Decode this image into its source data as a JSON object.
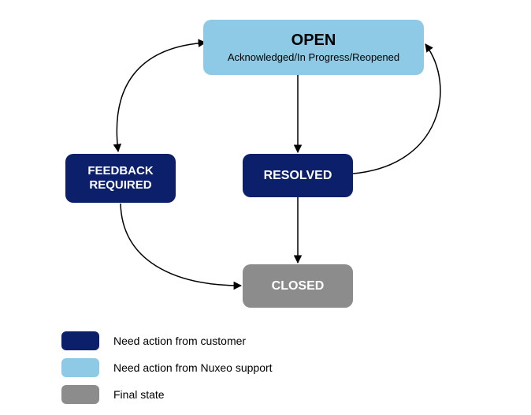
{
  "nodes": {
    "open": {
      "title": "OPEN",
      "subtitle": "Acknowledged/In Progress/Reopened"
    },
    "feedback": {
      "line1": "FEEDBACK",
      "line2": "REQUIRED"
    },
    "resolved": {
      "title": "RESOLVED"
    },
    "closed": {
      "title": "CLOSED"
    }
  },
  "legend": {
    "items": [
      {
        "color": "#0b1f6b",
        "label": "Need action from customer"
      },
      {
        "color": "#8ecae6",
        "label": "Need action from Nuxeo support"
      },
      {
        "color": "#8c8c8c",
        "label": "Final state"
      }
    ]
  },
  "edges": [
    {
      "from": "open",
      "to": "feedback",
      "bidirectional": true
    },
    {
      "from": "open",
      "to": "resolved",
      "bidirectional": false
    },
    {
      "from": "resolved",
      "to": "open",
      "bidirectional": false
    },
    {
      "from": "resolved",
      "to": "closed",
      "bidirectional": false
    },
    {
      "from": "feedback",
      "to": "closed",
      "bidirectional": false
    }
  ],
  "colors": {
    "customer_action": "#0b1f6b",
    "support_action": "#8ecae6",
    "final_state": "#8c8c8c"
  }
}
